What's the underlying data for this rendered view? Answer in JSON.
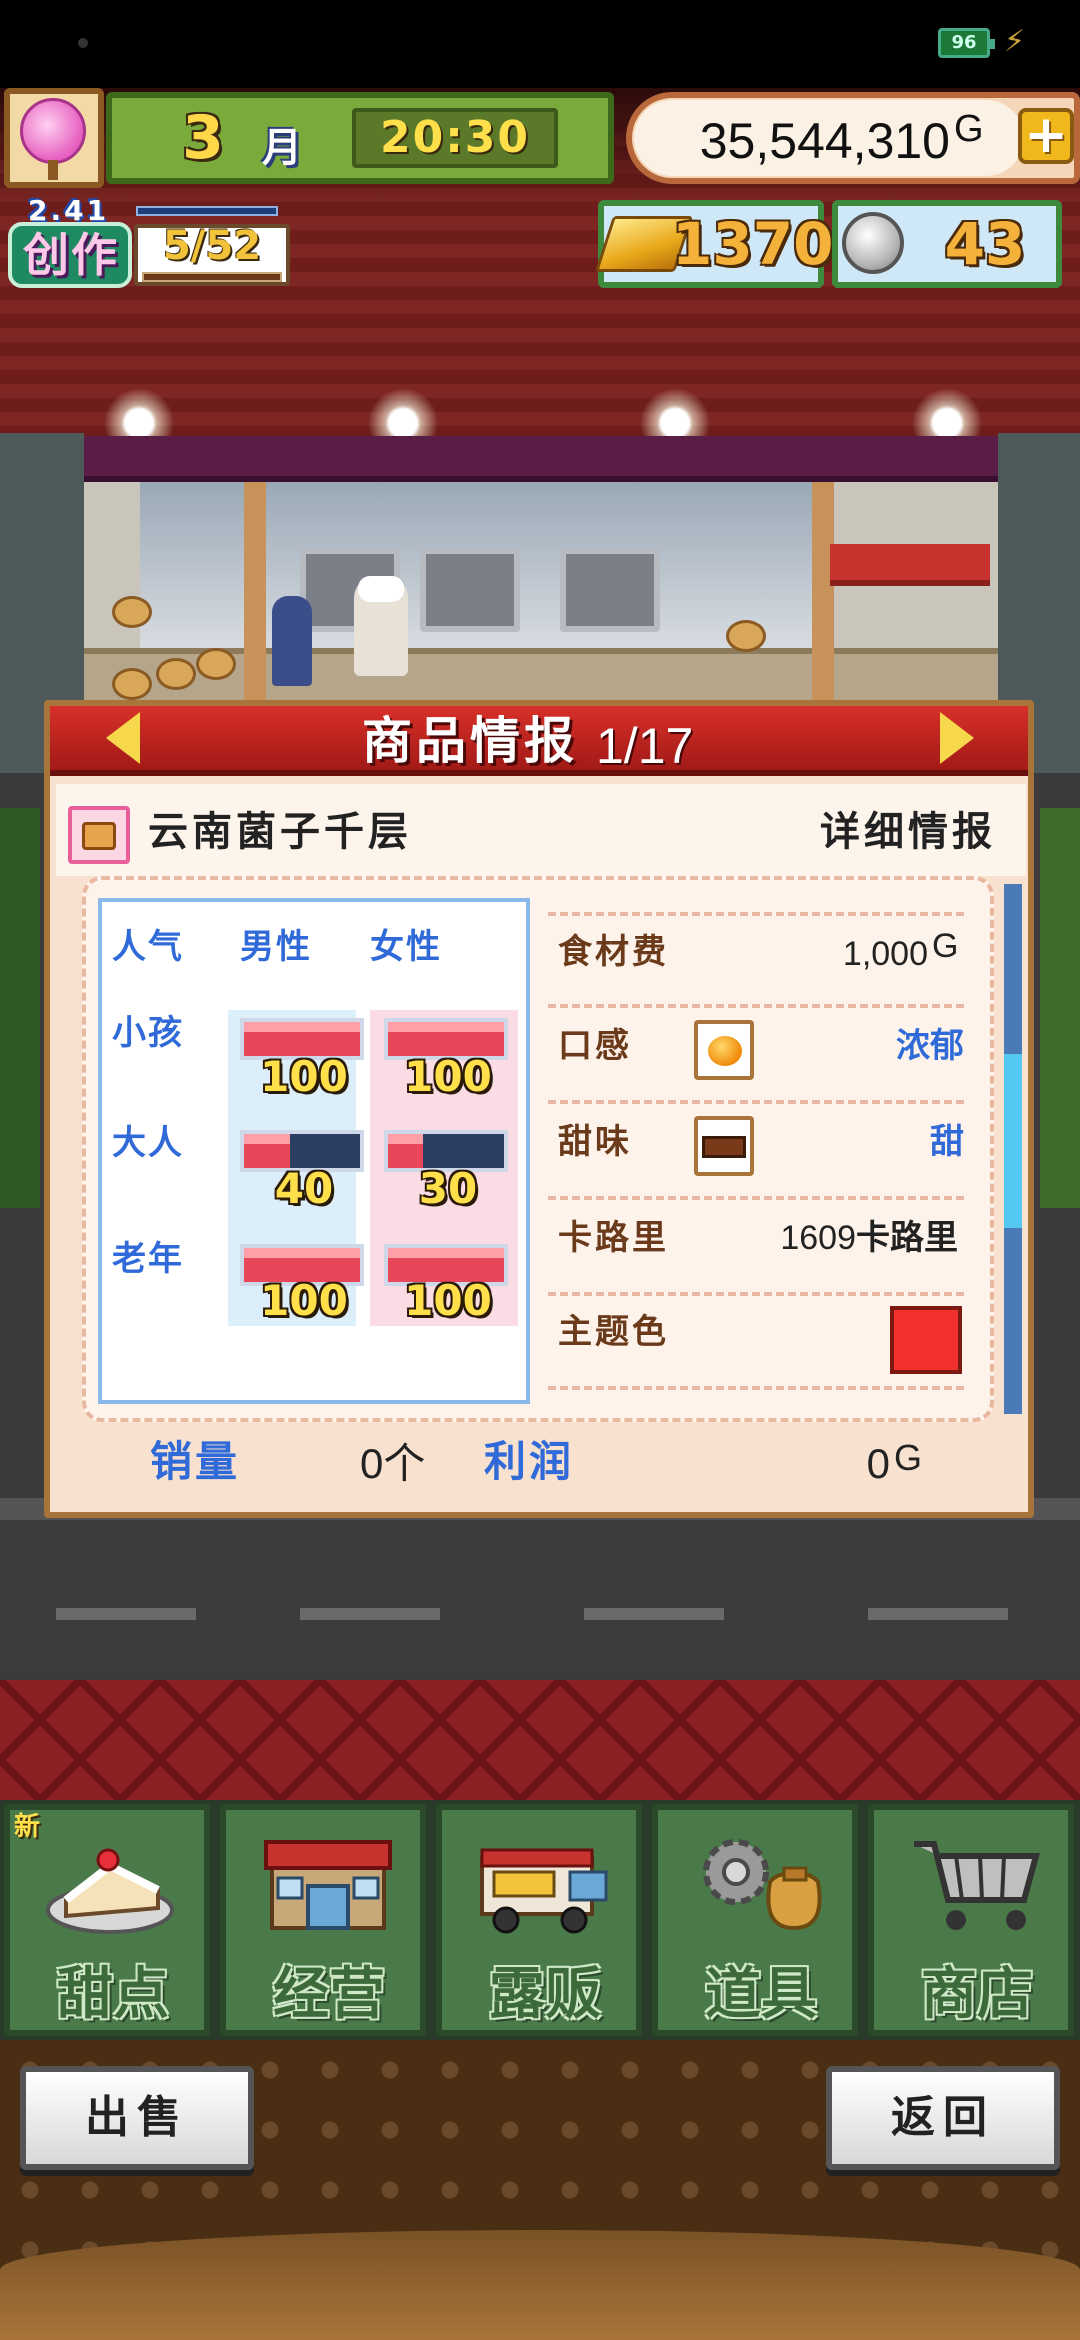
{
  "status": {
    "battery": "96"
  },
  "hud": {
    "month_num": "3",
    "month_label": "月",
    "time": "20:30",
    "money": "35,544,310",
    "money_unit": "G",
    "add_label": "+",
    "create_version": "2.41",
    "create_label": "创作",
    "create_count": "5/52",
    "gold": "1370",
    "coins": "43"
  },
  "dialog": {
    "title": "商品情报",
    "page": "1/17",
    "product_name": "云南菌子千层",
    "detail_label": "详细情报",
    "popularity": {
      "header": "人气",
      "male": "男性",
      "female": "女性",
      "rows": [
        {
          "label": "小孩",
          "male": "100",
          "female": "100",
          "male_level": 1.0,
          "female_level": 1.0
        },
        {
          "label": "大人",
          "male": "40",
          "female": "30",
          "male_level": 0.4,
          "female_level": 0.3
        },
        {
          "label": "老年",
          "male": "100",
          "female": "100",
          "male_level": 1.0,
          "female_level": 1.0
        }
      ]
    },
    "stats": {
      "cost_label": "食材费",
      "cost_value": "1,000",
      "cost_unit": "G",
      "texture_label": "口感",
      "texture_value": "浓郁",
      "sweet_label": "甜味",
      "sweet_value": "甜",
      "calorie_label": "卡路里",
      "calorie_value": "1609",
      "calorie_unit": "卡路里",
      "color_label": "主题色",
      "color_hex": "#f2302e"
    },
    "sales_label": "销量",
    "sales_value": "0个",
    "profit_label": "利润",
    "profit_value": "0",
    "profit_unit": "G"
  },
  "nav": {
    "new_badge": "新",
    "tabs": [
      {
        "label": "甜点",
        "icon": "cake-icon"
      },
      {
        "label": "经营",
        "icon": "shop-building-icon"
      },
      {
        "label": "露贩",
        "icon": "food-truck-icon"
      },
      {
        "label": "道具",
        "icon": "gear-bag-icon"
      },
      {
        "label": "商店",
        "icon": "shopping-cart-icon"
      }
    ]
  },
  "actions": {
    "sell": "出售",
    "back": "返回"
  }
}
